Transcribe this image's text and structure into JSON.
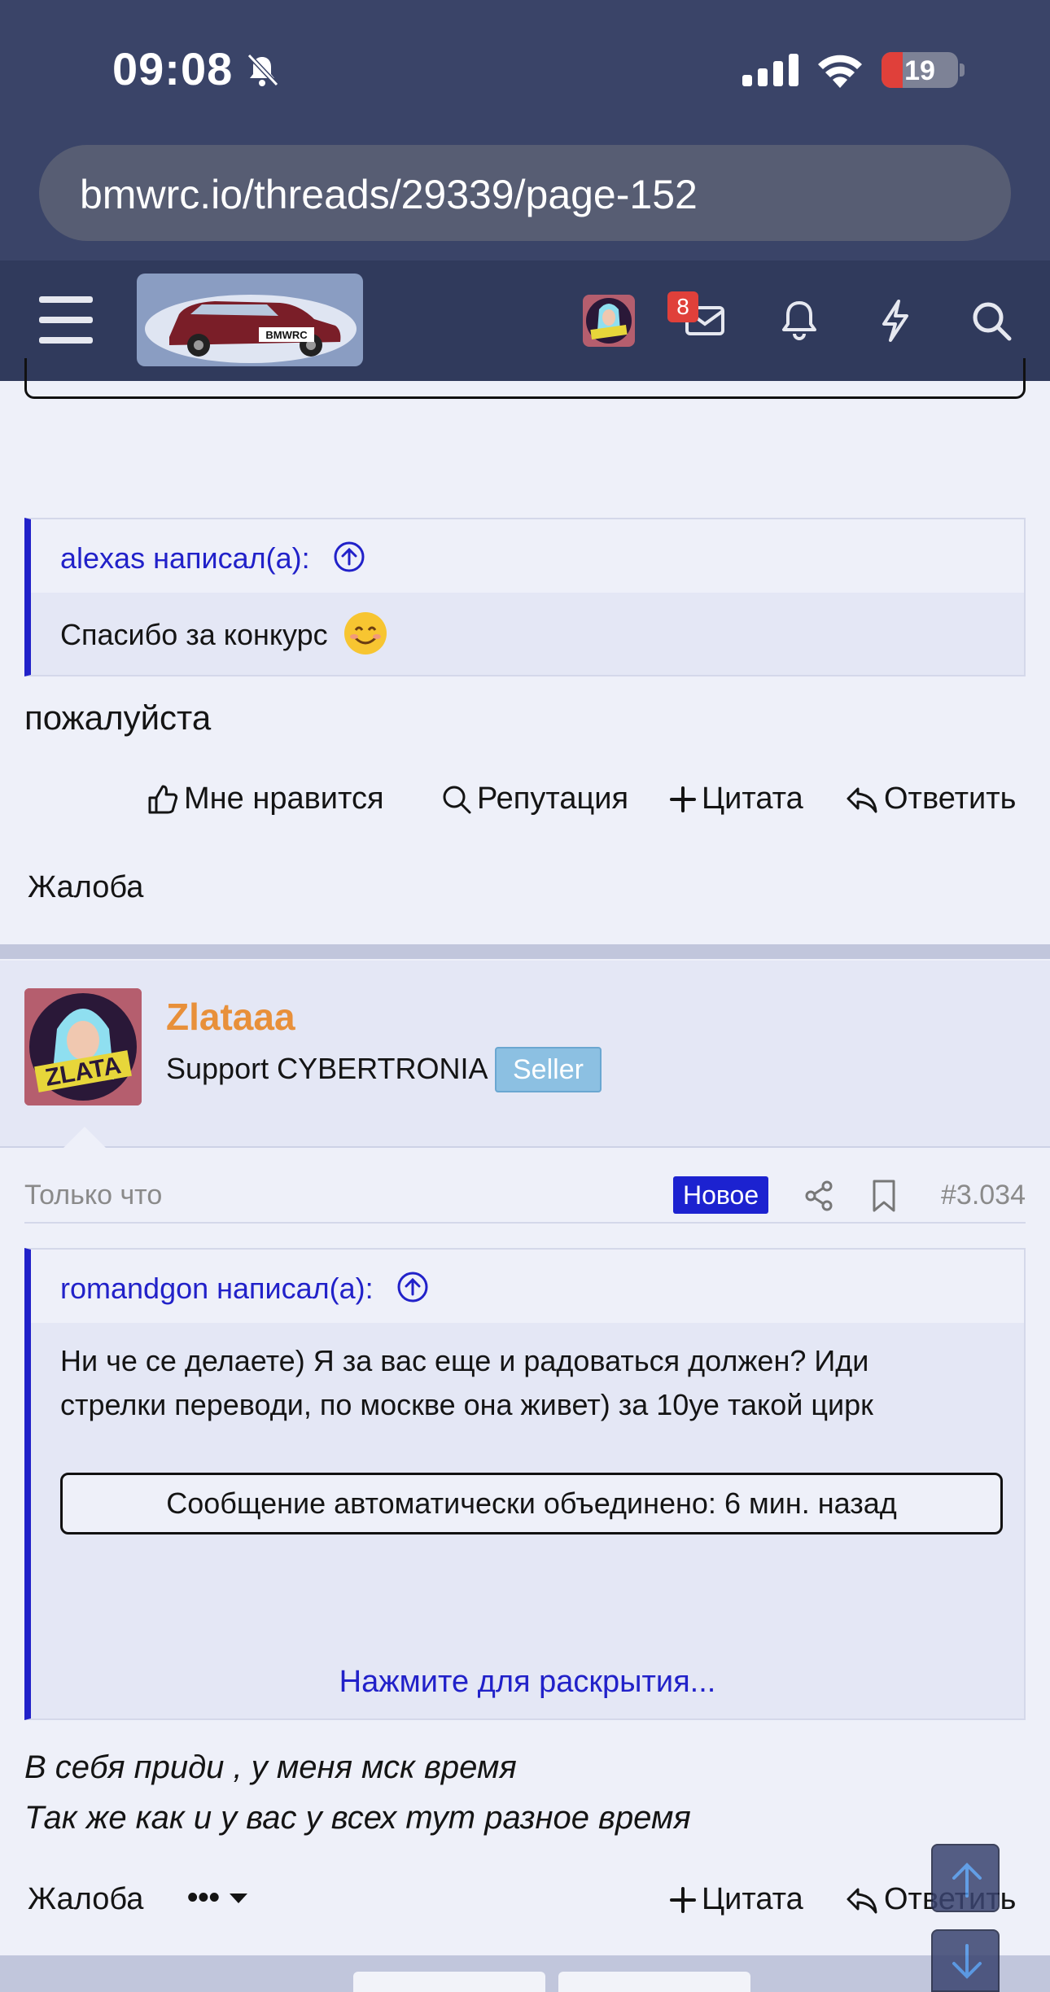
{
  "status_bar": {
    "time": "09:08",
    "battery": "19"
  },
  "browser": {
    "url": "bmwrc.io/threads/29339/page-152"
  },
  "header": {
    "logo_text": "BMWRC",
    "inbox_count": "8"
  },
  "post1": {
    "quote_author": "alexas написал(а):",
    "quote_text": "Спасибо за конкурс",
    "message": "пожалуйста",
    "actions": {
      "like": "Мне нравится",
      "reputation": "Репутация",
      "quote": "Цитата",
      "reply": "Ответить",
      "report": "Жалоба"
    }
  },
  "post2": {
    "username": "Zlataaa",
    "user_title": "Support CYBERTRONIA",
    "banner": "Seller",
    "avatar_text": "ZLATA",
    "time": "Только что",
    "new_label": "Новое",
    "post_number": "#3.034",
    "quote_author": "romandgon написал(а):",
    "quote_text": "Ни че се делаете) Я за вас еще и радоваться должен? Иди стрелки переводи, по москве она живет) за 10уе такой цирк",
    "merged_notice": "Сообщение автоматически объединено: 6 мин. назад",
    "expand_link": "Нажмите для раскрытия...",
    "message_line1": "В себя приди , у меня мск время",
    "message_line2": "Так же как и у вас у всех тут разное время",
    "actions": {
      "report": "Жалоба",
      "more": "•••",
      "quote": "Цитата",
      "reply": "Ответить"
    }
  }
}
